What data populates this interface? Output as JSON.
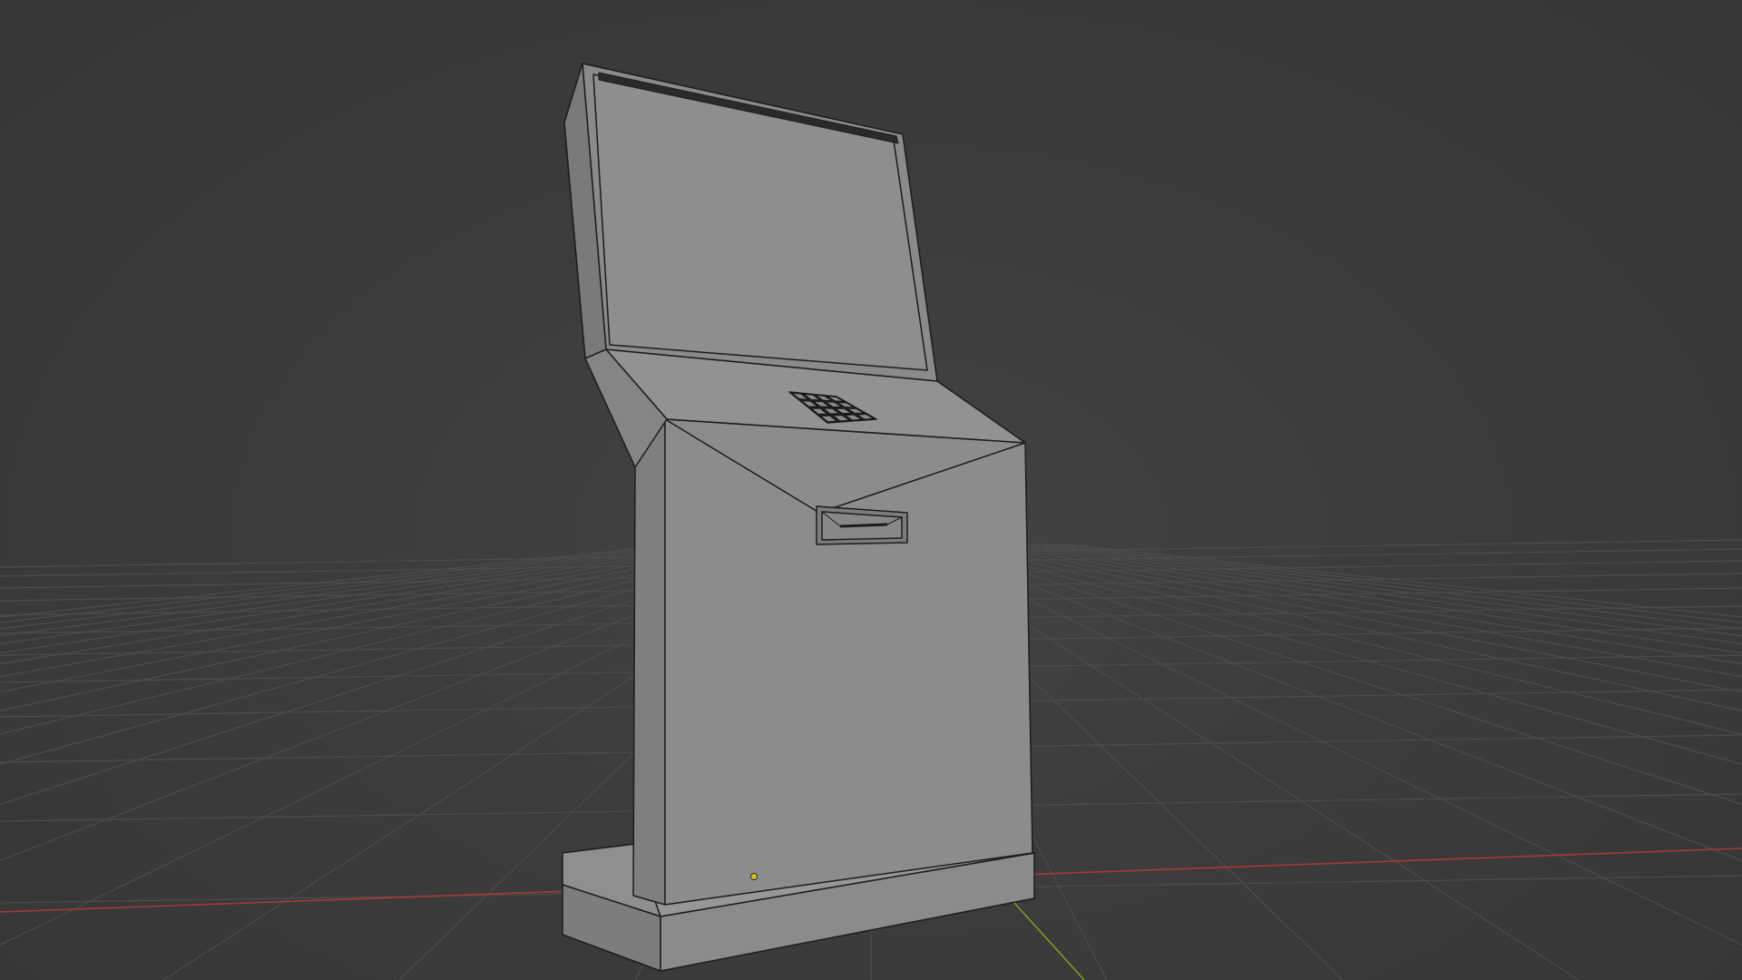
{
  "viewport": {
    "mode": "3d-viewport",
    "shading": "solid",
    "background_color": "#3d3d3d",
    "grid_color": "#4f4f4f",
    "x_axis_color": "#a33a3a",
    "y_axis_color": "#7a9a26",
    "mesh_color": "#8a8a8a",
    "edge_color": "#1a1a1a",
    "origin_color": "#e0c020"
  },
  "scene_object": {
    "name_icon": "kiosk-mesh",
    "parts": [
      "screen-panel",
      "upper-deck",
      "keypad",
      "card-slot",
      "cabinet-body",
      "base-plinth"
    ],
    "keypad": {
      "rows": 4,
      "columns": 4
    }
  }
}
